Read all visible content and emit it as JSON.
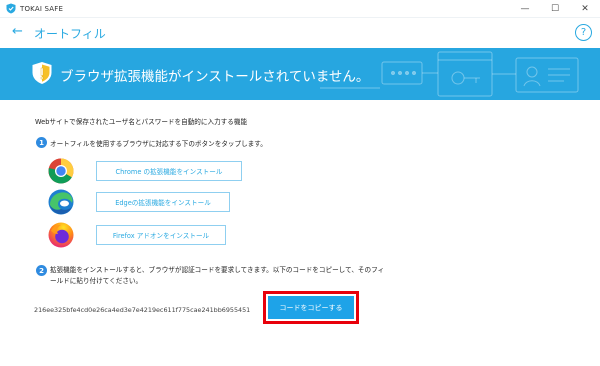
{
  "window": {
    "app_title": "TOKAI SAFE",
    "controls": {
      "minimize": "—",
      "maximize": "☐",
      "close": "✕"
    }
  },
  "header": {
    "back_icon": "←",
    "title": "オートフィル",
    "help_icon": "?"
  },
  "banner": {
    "message": "ブラウザ拡張機能がインストールされていません。",
    "color": "#27a6e0"
  },
  "main": {
    "description": "Webサイトで保存されたユーザ名とパスワードを自動的に入力する機能",
    "step1": {
      "number": "1",
      "text": "オートフィルを使用するブラウザに対応する下のボタンをタップします。"
    },
    "browsers": [
      {
        "icon": "chrome-icon",
        "label": "Chrome の拡張機能をインストール"
      },
      {
        "icon": "edge-icon",
        "label": "Edgeの拡張機能をインストール"
      },
      {
        "icon": "firefox-icon",
        "label": "Firefox アドオンをインストール"
      }
    ],
    "step2": {
      "number": "2",
      "text": "拡張機能をインストールすると、ブラウザが認証コードを要求してきます。以下のコードをコピーして、そのフィールドに貼り付けてください。"
    },
    "auth_code": "216ee325bfe4cd0e26ca4ed3e7e4219ec611f775cae241bb6955451",
    "copy_button": "コードをコピーする"
  },
  "colors": {
    "accent": "#29a9e1",
    "highlight": "#e8000b",
    "button": "#1ea3e8"
  }
}
